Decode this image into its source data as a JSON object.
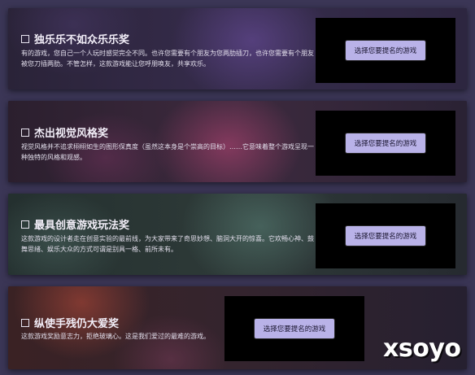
{
  "awards": [
    {
      "title": "独乐乐不如众乐乐奖",
      "description": "有的游戏，您自己一个人玩时感觉完全不同。也许您需要有个朋友为您两肋插刀，也许您需要有个朋友被您刀插两肋。不管怎样，这款游戏能让您呼朋唤友，共享欢乐。",
      "button_label": "选择您要提名的游戏"
    },
    {
      "title": "杰出视觉风格奖",
      "description": "视觉风格并不追求栩栩如生的图形保真度（虽然这本身是个崇高的目标）……它意味着整个游戏呈现一种独特的风格和观感。",
      "button_label": "选择您要提名的游戏"
    },
    {
      "title": "最具创意游戏玩法奖",
      "description": "这款游戏的设计者走在创意实验的最前线，为大家带来了奇思妙想、脑洞大开的惊喜。它欢畅心神、鼓舞思绪、娱乐大众的方式可谓是别具一格、前所未有。",
      "button_label": "选择您要提名的游戏"
    },
    {
      "title": "纵使手残仍大爱奖",
      "description": "这款游戏奖励意志力，拒绝玻璃心。这是我们爱过的最难的游戏。",
      "button_label": "选择您要提名的游戏"
    }
  ],
  "watermark": "xsoyo",
  "colors": {
    "page_background": "#3b3656",
    "button_background": "#b9b2e8",
    "nominee_panel": "#000000"
  }
}
